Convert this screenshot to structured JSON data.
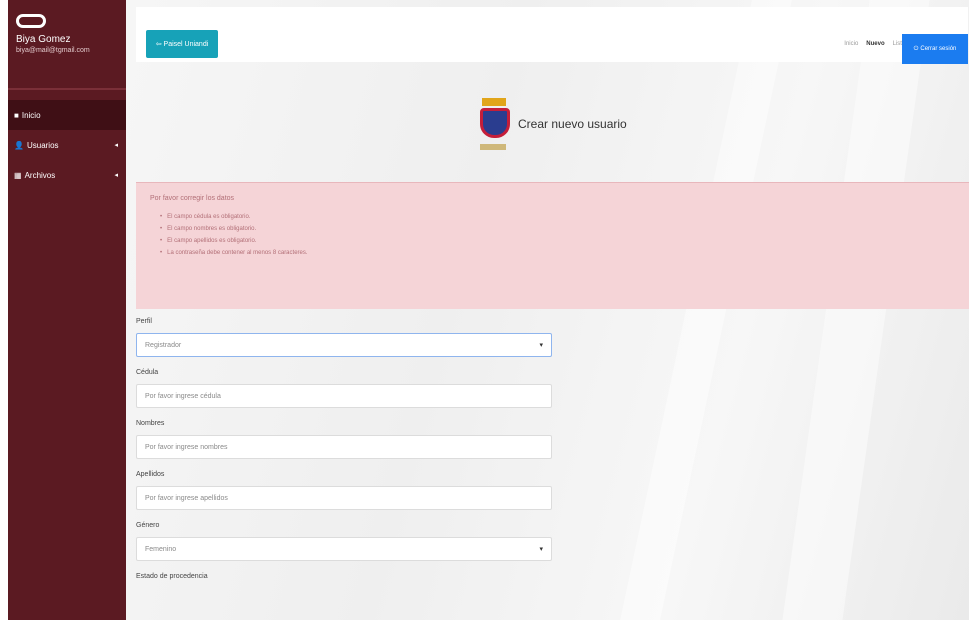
{
  "sidebar": {
    "user_name": "Biya Gomez",
    "user_email": "biya@mail@tgmail.com",
    "items": [
      {
        "icon": "home-icon",
        "glyph": "■",
        "label": "Inicio"
      },
      {
        "icon": "users-icon",
        "glyph": "👤",
        "label": "Usuarios",
        "chevron": "◂"
      },
      {
        "icon": "building-icon",
        "glyph": "▦",
        "label": "Archivos",
        "chevron": "◂"
      }
    ]
  },
  "topbar": {
    "back_label": "⇦ Paisel Uniandi",
    "breadcrumbs": [
      "Inicio",
      "Nuevo",
      "Listado"
    ],
    "logout_icon": "logout-icon",
    "logout_label": "Cerrar sesión"
  },
  "brand": {
    "title": "Crear nuevo usuario"
  },
  "alert": {
    "title": "Por favor corregir los datos",
    "items": [
      "El campo cédula es obligatorio.",
      "El campo nombres es obligatorio.",
      "El campo apellidos es obligatorio.",
      "La contraseña debe contener al menos 8 caracteres."
    ]
  },
  "form": {
    "perfil": {
      "label": "Perfil",
      "value": "Registrador"
    },
    "cedula": {
      "label": "Cédula",
      "placeholder": "Por favor ingrese cédula"
    },
    "nombres": {
      "label": "Nombres",
      "placeholder": "Por favor ingrese nombres"
    },
    "apellidos": {
      "label": "Apellidos",
      "placeholder": "Por favor ingrese apellidos"
    },
    "genero": {
      "label": "Género",
      "value": "Femenino"
    },
    "estado_label": "Estado de procedencia"
  },
  "colors": {
    "sidebar": "#5b1a22",
    "primary": "#1b7cf0",
    "info": "#17a2b8",
    "alert_bg": "#f5d4d7"
  }
}
